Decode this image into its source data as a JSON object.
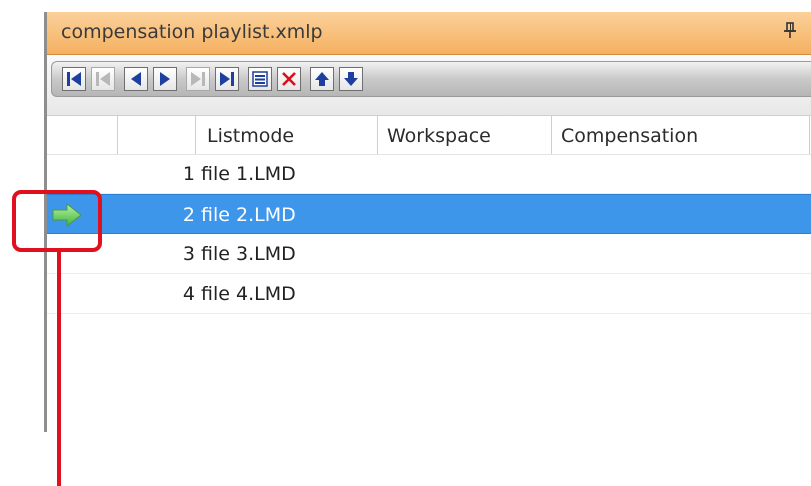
{
  "window": {
    "title": "compensation playlist.xmlp",
    "pin_icon": "pin-icon"
  },
  "toolbar": {
    "buttons": [
      {
        "name": "first-button",
        "icon": "skip-first-icon",
        "enabled": true
      },
      {
        "name": "first-disabled-button",
        "icon": "skip-first-icon",
        "enabled": false
      },
      {
        "name": "previous-button",
        "icon": "play-back-icon",
        "enabled": true
      },
      {
        "name": "play-button",
        "icon": "play-icon",
        "enabled": true
      },
      {
        "name": "next-disabled-button",
        "icon": "skip-last-icon",
        "enabled": false
      },
      {
        "name": "last-button",
        "icon": "skip-last-icon",
        "enabled": true
      },
      {
        "name": "list-button",
        "icon": "list-icon",
        "enabled": true
      },
      {
        "name": "delete-button",
        "icon": "delete-icon",
        "enabled": true
      },
      {
        "name": "move-up-button",
        "icon": "arrow-up-icon",
        "enabled": true
      },
      {
        "name": "move-down-button",
        "icon": "arrow-down-icon",
        "enabled": true
      }
    ]
  },
  "columns": [
    "Listmode",
    "Workspace",
    "Compensation"
  ],
  "rows": [
    {
      "num": "1",
      "name": "file 1.LMD",
      "selected": false,
      "active": false
    },
    {
      "num": "2",
      "name": "file 2.LMD",
      "selected": true,
      "active": true
    },
    {
      "num": "3",
      "name": "file 3.LMD",
      "selected": false,
      "active": false
    },
    {
      "num": "4",
      "name": "file 4.LMD",
      "selected": false,
      "active": false
    }
  ],
  "colors": {
    "title_bar": "#f5b061",
    "selection": "#3d96e9",
    "toolbar_icon": "#1d3f9e",
    "delete_icon": "#d8101a",
    "active_arrow": "#6ad35a",
    "callout": "#e0101e"
  },
  "annotation": {
    "shape": "rounded-rectangle-callout",
    "target": "active-row-indicator"
  }
}
